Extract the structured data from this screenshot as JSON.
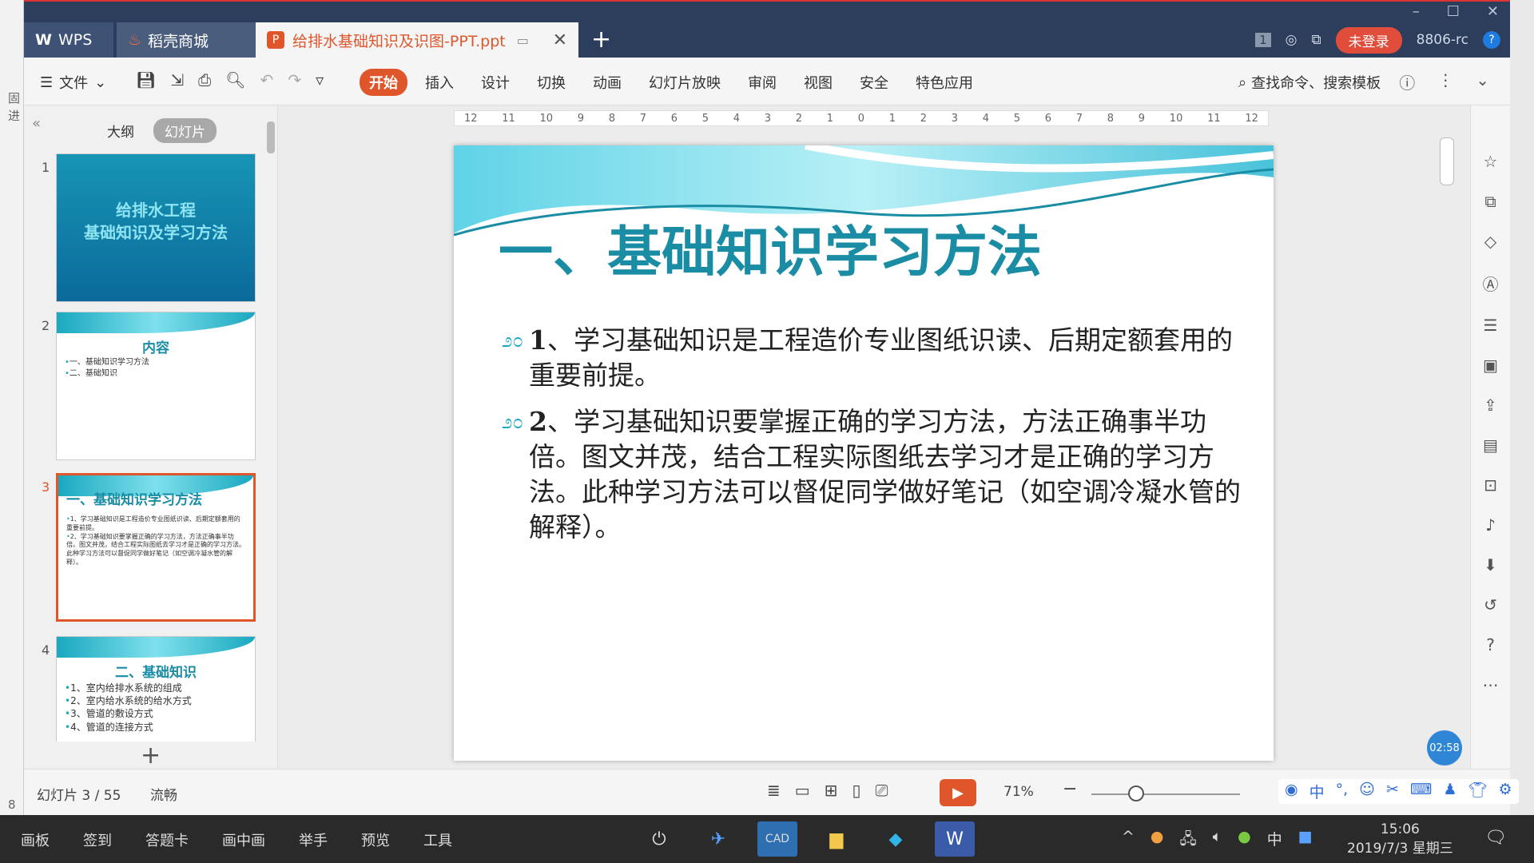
{
  "left_strip": {
    "labels": [
      "固",
      "进",
      "8"
    ]
  },
  "titlebar": {
    "tabs": [
      {
        "label": "WPS",
        "glyph": "W"
      },
      {
        "label": "稻壳商城",
        "glyph": "♨"
      },
      {
        "label": "给排水基础知识及识图-PPT.ppt",
        "glyph": "P"
      }
    ],
    "add_tab": "+",
    "page_badge": "1",
    "login": "未登录",
    "user": "8806-rc",
    "help": "?"
  },
  "ribbon": {
    "menu_label": "文件",
    "tabs": [
      "开始",
      "插入",
      "设计",
      "切换",
      "动画",
      "幻灯片放映",
      "审阅",
      "视图",
      "安全",
      "特色应用"
    ],
    "active_tab": "开始",
    "search_label": "查找命令、搜索模板"
  },
  "slide_panel": {
    "views": [
      "大纲",
      "幻灯片"
    ],
    "active_view": "幻灯片",
    "thumbs": [
      {
        "num": "1",
        "title_lines": [
          "给排水工程",
          "基础知识及学习方法"
        ]
      },
      {
        "num": "2",
        "title": "内容",
        "lines": [
          "一、基础知识学习方法",
          "二、基础知识"
        ]
      },
      {
        "num": "3",
        "title": "一、基础知识学习方法",
        "lines": [
          "1、学习基础知识是工程造价专业图纸识读、后期定额套用的重要前提。",
          "2、学习基础知识要掌握正确的学习方法，方法正确事半功倍。图文并茂，结合工程实际图纸去学习才是正确的学习方法。此种学习方法可以督促同学做好笔记（如空调冷凝水管的解释）。"
        ]
      },
      {
        "num": "4",
        "title": "二、基础知识",
        "lines": [
          "1、室内给排水系统的组成",
          "2、室内给水系统的给水方式",
          "3、管道的敷设方式",
          "4、管道的连接方式"
        ]
      }
    ],
    "selected": "3",
    "add_slide": "+"
  },
  "ruler": {
    "ticks": [
      "12",
      "11",
      "10",
      "9",
      "8",
      "7",
      "6",
      "5",
      "4",
      "3",
      "2",
      "1",
      "0",
      "1",
      "2",
      "3",
      "4",
      "5",
      "6",
      "7",
      "8",
      "9",
      "10",
      "11",
      "12"
    ]
  },
  "slide": {
    "title": "一、基础知识学习方法",
    "bullet_glyph": "೨೦",
    "points": [
      {
        "num": "1",
        "text": "、学习基础知识是工程造价专业图纸识读、后期定额套用的重要前提。"
      },
      {
        "num": "2",
        "text": "、学习基础知识要掌握正确的学习方法，方法正确事半功倍。图文并茂，结合工程实际图纸去学习才是正确的学习方法。此种学习方法可以督促同学做好笔记（如空调冷凝水管的解释）。"
      }
    ]
  },
  "timer": "02:58",
  "status": {
    "slide_info": "幻灯片 3 / 55",
    "theme": "流畅",
    "zoom": "71%",
    "zoom_level_percent": 30
  },
  "taskbar": {
    "left_items": [
      "画板",
      "签到",
      "答题卡",
      "画中画",
      "举手",
      "预览",
      "工具"
    ],
    "apps": [
      "power-icon",
      "cad-icon",
      "folder-icon",
      "app-icon",
      "wps-icon"
    ],
    "ime": "中",
    "time": "15:06",
    "date": "2019/7/3 星期三"
  },
  "colors": {
    "accent": "#e0562b",
    "title_teal": "#1a8da5",
    "titlebar": "#2c3e5c"
  }
}
